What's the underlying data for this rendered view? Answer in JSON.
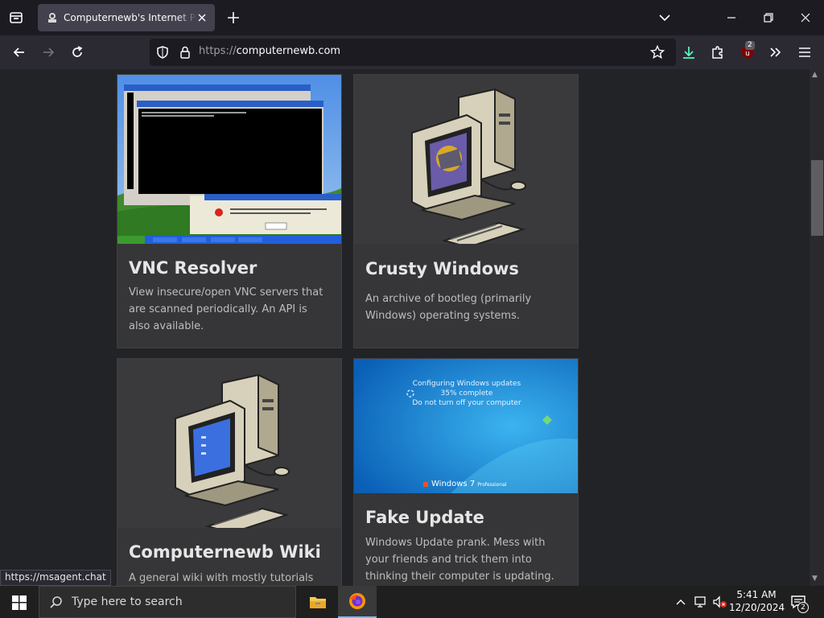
{
  "browser": {
    "tab_title": "Computernewb's Internet Pub | Home",
    "url_protocol": "https://",
    "url_host": "computernewb.com",
    "extension_badge": "2",
    "status_link": "https://msagent.chat"
  },
  "thumbs": {
    "win_update_line1": "Configuring Windows updates",
    "win_update_line2": "35% complete",
    "win_update_line3": "Do not turn off your computer",
    "win7_logo": "Windows 7",
    "win7_edition": "Professional"
  },
  "cards": [
    {
      "title": "VNC Resolver",
      "description": "View insecure/open VNC servers that are scanned periodically. An API is also available."
    },
    {
      "title": "Crusty Windows",
      "description": "An archive of bootleg (primarily Windows) operating systems."
    },
    {
      "title": "Computernewb Wiki",
      "description": "A general wiki with mostly tutorials and"
    },
    {
      "title": "Fake Update",
      "description": "Windows Update prank. Mess with your friends and trick them into thinking their computer is updating."
    }
  ],
  "taskbar": {
    "search_placeholder": "Type here to search",
    "time": "5:41 AM",
    "date": "12/20/2024",
    "notification_count": "2"
  },
  "colors": {
    "tab_bg": "#42414d",
    "nav_bg": "#2b2a33",
    "url_bg": "#1c1b22",
    "page_bg": "#222326",
    "card_bg": "#363638",
    "download_accent": "#54ffbd"
  }
}
